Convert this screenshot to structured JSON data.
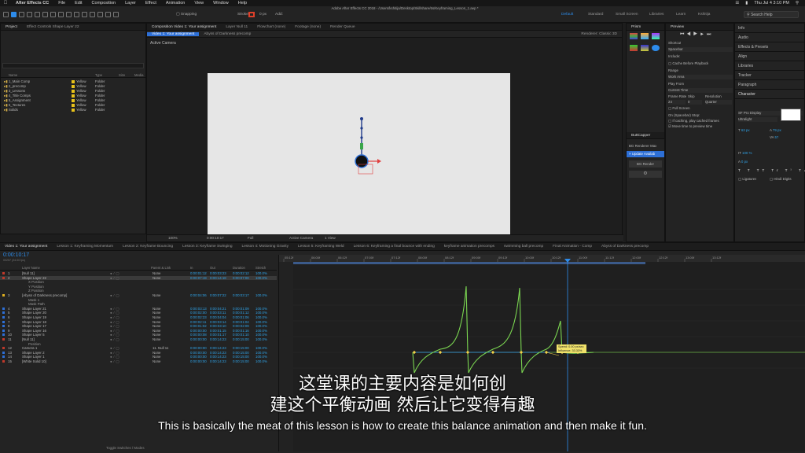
{
  "menubar": {
    "app_name": "After Effects CC",
    "menu_items": [
      "File",
      "Edit",
      "Composition",
      "Layer",
      "Effect",
      "Animation",
      "View",
      "Window",
      "Help"
    ],
    "window_title": "Adobe After Effects CC 2018 - /Users/kshitija/Desktop/Skillshare/6s/Keyframing_Lesson_1.aep *",
    "clock": "Thu Jul 4  3:10 PM"
  },
  "toolbar": {
    "workspaces": [
      "Default",
      "Standard",
      "Small Screen",
      "Libraries",
      "Learn",
      "Kshitija"
    ],
    "search_placeholder": "Search Help",
    "snapping_label": "Snapping",
    "stroke_label": "Stroke",
    "stroke_value": "0 px",
    "add_label": "Add:"
  },
  "project_panel": {
    "tab": "Project",
    "effect_controls_tab": "Effect Controls Shape Layer 22",
    "columns": [
      "Name",
      "Type",
      "Size",
      "Media"
    ],
    "items": [
      {
        "name": "1_Main Comp",
        "label": "Yellow",
        "type": "Folder"
      },
      {
        "name": "2_precomp",
        "label": "Yellow",
        "type": "Folder"
      },
      {
        "name": "3_Lessons",
        "label": "Yellow",
        "type": "Folder"
      },
      {
        "name": "4_Title Comps",
        "label": "Yellow",
        "type": "Folder"
      },
      {
        "name": "5_Assignment",
        "label": "Yellow",
        "type": "Folder"
      },
      {
        "name": "5_Textures",
        "label": "Yellow",
        "type": "Folder"
      },
      {
        "name": "Solids",
        "label": "Yellow",
        "type": "Folder"
      }
    ]
  },
  "composition_panel": {
    "tab": "Composition Video 1: Your assignment",
    "secondary_tabs": [
      "Layer Null 11",
      "Flowchart (none)",
      "Footage (none)",
      "Render Queue"
    ],
    "subtabs": [
      "Video 1: Your assignment",
      "Abyss of Darkness precomp"
    ],
    "active_camera": "Active Camera",
    "renderer_label": "Renderer: Classic 3D",
    "zoom": "100%",
    "timecode": "0:00:10:17",
    "quality": "Full",
    "view_camera": "Active Camera",
    "views": "1 View"
  },
  "preview_panel": {
    "title": "Preview",
    "shortcut_label": "Shortcut",
    "shortcut_value": "Spacebar",
    "include_label": "Include:",
    "cache_label": "Cache Before Playback",
    "range_label": "Range",
    "range_value": "Work Area",
    "play_from_label": "Play From",
    "play_from_value": "Current Time",
    "frame_rate_label": "Frame Rate",
    "skip_label": "Skip",
    "resolution_label": "Resolution",
    "frame_rate": "24",
    "skip": "0",
    "resolution": "Quarter",
    "full_screen_label": "Full Screen",
    "stop_label": "On (Spacebar) Stop:",
    "stop_opt1": "If caching, play cached frames",
    "stop_opt2": "Move time to preview time"
  },
  "prism_panel": {
    "title": "Prism"
  },
  "buttcapper_panel": {
    "title": "ButtCapper",
    "bg_renderer_max": "BG Renderer Max",
    "update_label": "Update Availab",
    "bg_render_button": "BG Render"
  },
  "right_panels": {
    "items": [
      "Info",
      "Audio",
      "Effects & Presets",
      "Align",
      "Libraries",
      "Tracker",
      "Paragraph",
      "Character"
    ],
    "font": "SF Pro Display",
    "font_style": "Ultralight",
    "font_size": "63 px",
    "leading": "79 px",
    "tracking": "57",
    "scale": "100 %",
    "baseline": "0 px",
    "ligatures": "Ligatures",
    "hindi_digits": "Hindi Digits"
  },
  "timeline": {
    "tabs": [
      "Video 1: Your assignment",
      "Lesson 1: Keyframing Momentum",
      "Lesson 2: Keyframe Bouncing",
      "Lesson 3: Keyframe Swinging",
      "Lesson 4: Motioning Gravity",
      "Lesson 5: Keyframing Weld",
      "Lesson 6: Keyframing a final bounce with ending",
      "keyframe animation precomps",
      "swimming ball precomp",
      "Final Animation - Comp",
      "Abyss of Darkness precomp"
    ],
    "timecode": "0:00:10:17",
    "timecode_sub": "00257 (24.00 fps)",
    "search_placeholder": "",
    "columns": [
      "Layer Name",
      "Parent & Link",
      "In",
      "Out",
      "Duration",
      "Stretch"
    ],
    "layers": [
      {
        "n": "1",
        "name": "[Null 11]",
        "parent": "None",
        "in": "0:00:01:12",
        "out": "0:00:03:23",
        "dur": "0:00:02:12",
        "stretch": "100.0%",
        "color": "#c0392b"
      },
      {
        "n": "2",
        "name": "Shape Layer 22",
        "parent": "None",
        "in": "0:00:07:19",
        "out": "0:00:14:18",
        "dur": "0:00:07:00",
        "stretch": "100.0%",
        "color": "#c0392b"
      },
      {
        "n": "",
        "name": "X Position",
        "parent": "",
        "in": "",
        "out": "",
        "dur": "",
        "stretch": "",
        "color": ""
      },
      {
        "n": "",
        "name": "Y Position",
        "parent": "",
        "in": "",
        "out": "",
        "dur": "",
        "stretch": "",
        "color": ""
      },
      {
        "n": "",
        "name": "Z Position",
        "parent": "",
        "in": "",
        "out": "",
        "dur": "",
        "stretch": "",
        "color": ""
      },
      {
        "n": "3",
        "name": "[Abyss of Darkness precomp]",
        "parent": "None",
        "in": "0:00:04:06",
        "out": "0:00:07:22",
        "dur": "0:00:03:17",
        "stretch": "100.0%",
        "color": "#e0b020"
      },
      {
        "n": "",
        "name": "Mask 1",
        "parent": "",
        "in": "",
        "out": "",
        "dur": "",
        "stretch": "",
        "color": ""
      },
      {
        "n": "",
        "name": "Mask Path",
        "parent": "",
        "in": "",
        "out": "",
        "dur": "",
        "stretch": "",
        "color": ""
      },
      {
        "n": "4",
        "name": "Shape Layer 21",
        "parent": "None",
        "in": "0:00:03:13",
        "out": "0:00:04:21",
        "dur": "0:00:01:09",
        "stretch": "100.0%",
        "color": "#2d6fd6"
      },
      {
        "n": "5",
        "name": "Shape Layer 20",
        "parent": "None",
        "in": "0:00:02:00",
        "out": "0:00:03:11",
        "dur": "0:00:01:12",
        "stretch": "100.0%",
        "color": "#2d6fd6"
      },
      {
        "n": "6",
        "name": "Shape Layer 19",
        "parent": "None",
        "in": "0:00:02:23",
        "out": "0:00:04:04",
        "dur": "0:00:01:06",
        "stretch": "100.0%",
        "color": "#2d6fd6"
      },
      {
        "n": "7",
        "name": "Shape Layer 18",
        "parent": "None",
        "in": "0:00:02:11",
        "out": "0:00:03:14",
        "dur": "0:00:01:04",
        "stretch": "100.0%",
        "color": "#2d6fd6"
      },
      {
        "n": "8",
        "name": "Shape Layer 17",
        "parent": "None",
        "in": "0:00:01:02",
        "out": "0:00:03:10",
        "dur": "0:00:02:09",
        "stretch": "100.0%",
        "color": "#2d6fd6"
      },
      {
        "n": "9",
        "name": "Shape Layer 16",
        "parent": "None",
        "in": "0:00:00:00",
        "out": "0:00:01:15",
        "dur": "0:00:01:16",
        "stretch": "100.0%",
        "color": "#2d6fd6"
      },
      {
        "n": "10",
        "name": "Shape Layer 5",
        "parent": "None",
        "in": "0:00:00:08",
        "out": "0:00:01:17",
        "dur": "0:00:01:10",
        "stretch": "100.0%",
        "color": "#2d6fd6"
      },
      {
        "n": "11",
        "name": "[Null 11]",
        "parent": "None",
        "in": "0:00:00:00",
        "out": "0:00:14:23",
        "dur": "0:00:15:00",
        "stretch": "100.0%",
        "color": "#c0392b"
      },
      {
        "n": "",
        "name": "Position",
        "parent": "",
        "in": "",
        "out": "",
        "dur": "",
        "stretch": "",
        "color": ""
      },
      {
        "n": "12",
        "name": "Camera 1",
        "parent": "11. Null 11",
        "in": "0:00:00:00",
        "out": "0:00:14:23",
        "dur": "0:00:15:00",
        "stretch": "100.0%",
        "color": "#c0392b"
      },
      {
        "n": "13",
        "name": "Shape Layer 2",
        "parent": "None",
        "in": "0:00:00:00",
        "out": "0:00:14:23",
        "dur": "0:00:15:00",
        "stretch": "100.0%",
        "color": "#2d6fd6"
      },
      {
        "n": "14",
        "name": "Shape Layer 1",
        "parent": "None",
        "in": "0:00:00:00",
        "out": "0:00:14:23",
        "dur": "0:00:15:00",
        "stretch": "100.0%",
        "color": "#2d6fd6"
      },
      {
        "n": "15",
        "name": "[White Solid 10]",
        "parent": "None",
        "in": "0:00:00:00",
        "out": "0:00:14:23",
        "dur": "0:00:15:00",
        "stretch": "100.0%",
        "color": "#c0392b"
      }
    ],
    "ruler_labels": [
      "05:12f",
      "06:00f",
      "06:12f",
      "07:00f",
      "07:12f",
      "08:00f",
      "08:12f",
      "09:00f",
      "09:12f",
      "10:00f",
      "10:12f",
      "11:00f",
      "11:12f",
      "12:00f",
      "12:12f",
      "13:00f",
      "13:12f"
    ],
    "graph_y_labels": [
      "6000",
      "4000",
      "2000",
      "0",
      "-2000",
      "-4000"
    ],
    "graph_tooltip": {
      "speed": "Speed: 0.00 px/sec",
      "influence": "Influence: 33.33%"
    },
    "toggle_label": "Toggle Switches / Modes"
  },
  "subtitles": {
    "zh_line1": "这堂课的主要内容是如何创",
    "zh_line2": "建这个平衡动画 然后让它变得有趣",
    "en_line": "This is basically the meat of this lesson is how to create this balance animation and then make it fun."
  },
  "colors": {
    "accent_blue": "#2d8ceb",
    "graph_green": "#7bd651",
    "yellow_label": "#e8c21a"
  }
}
